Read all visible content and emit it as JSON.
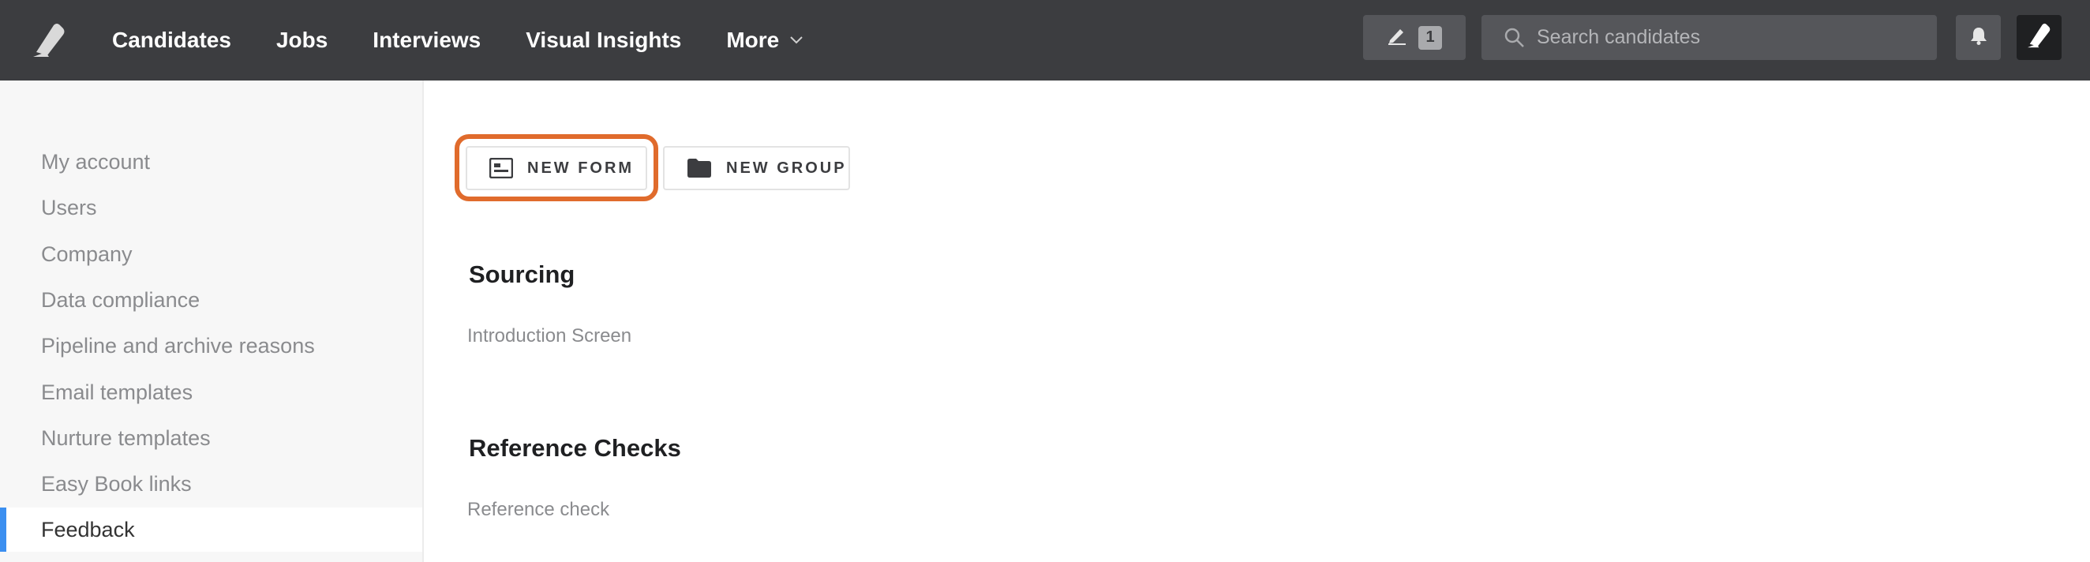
{
  "nav": {
    "items": [
      {
        "label": "Candidates"
      },
      {
        "label": "Jobs"
      },
      {
        "label": "Interviews"
      },
      {
        "label": "Visual Insights"
      },
      {
        "label": "More"
      }
    ],
    "edit_count": "1",
    "search_placeholder": "Search candidates"
  },
  "sidebar": {
    "items": [
      {
        "label": "My account"
      },
      {
        "label": "Users"
      },
      {
        "label": "Company"
      },
      {
        "label": "Data compliance"
      },
      {
        "label": "Pipeline and archive reasons"
      },
      {
        "label": "Email templates"
      },
      {
        "label": "Nurture templates"
      },
      {
        "label": "Easy Book links"
      },
      {
        "label": "Feedback"
      }
    ],
    "active": "Feedback"
  },
  "main": {
    "new_form_label": "NEW FORM",
    "new_group_label": "NEW GROUP",
    "groups": [
      {
        "title": "Sourcing",
        "forms": [
          "Introduction Screen"
        ]
      },
      {
        "title": "Reference Checks",
        "forms": [
          "Reference check"
        ]
      }
    ]
  },
  "colors": {
    "topbar": "#3c3d40",
    "accent": "#3b8ff0",
    "highlight": "#e06b2c"
  }
}
